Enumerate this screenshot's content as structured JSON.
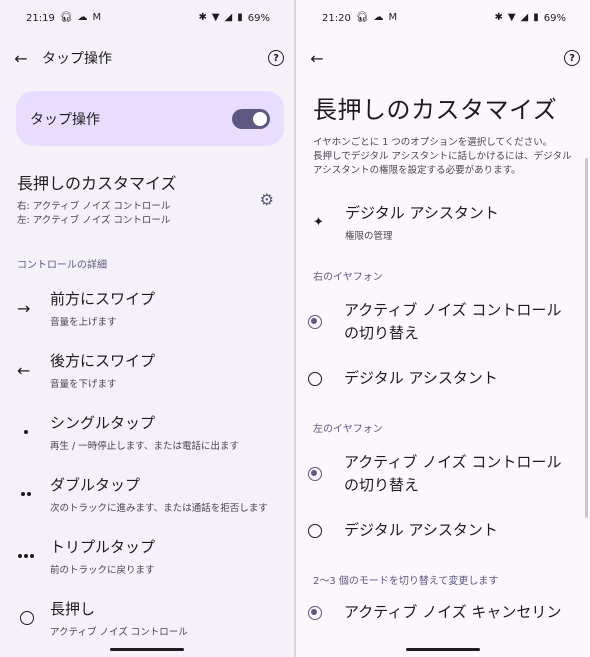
{
  "left": {
    "status": {
      "time": "21:19",
      "battery": "69%"
    },
    "appbar": {
      "title": "タップ操作"
    },
    "master_toggle": {
      "label": "タップ操作",
      "on": true
    },
    "long_press": {
      "title": "長押しのカスタマイズ",
      "right": "右: アクティブ ノイズ コントロール",
      "left": "左: アクティブ ノイズ コントロール"
    },
    "section": "コントロールの詳細",
    "items": [
      {
        "icon": "arrow-right-icon",
        "title": "前方にスワイプ",
        "subtitle": "音量を上げます"
      },
      {
        "icon": "arrow-left-icon",
        "title": "後方にスワイプ",
        "subtitle": "音量を下げます"
      },
      {
        "icon": "single-dot-icon",
        "title": "シングルタップ",
        "subtitle": "再生 / 一時停止します、または電話に出ます"
      },
      {
        "icon": "double-dot-icon",
        "title": "ダブルタップ",
        "subtitle": "次のトラックに進みます、または通話を拒否します"
      },
      {
        "icon": "triple-dot-icon",
        "title": "トリプルタップ",
        "subtitle": "前のトラックに戻ります"
      },
      {
        "icon": "circle-icon",
        "title": "長押し",
        "subtitle": "アクティブ ノイズ コントロール"
      }
    ]
  },
  "right": {
    "status": {
      "time": "21:20",
      "battery": "69%"
    },
    "heading": "長押しのカスタマイズ",
    "description": [
      "イヤホンごとに 1 つのオプションを選択してください。",
      "長押しでデジタル アシスタントに話しかけるには、デジタル",
      "アシスタントの権限を設定する必要があります。"
    ],
    "assistant": {
      "title": "デジタル アシスタント",
      "subtitle": "権限の管理"
    },
    "right_section": "右のイヤフォン",
    "right_options": [
      {
        "label_line1": "アクティブ ノイズ コントロール",
        "label_line2": "の切り替え",
        "selected": true
      },
      {
        "label_line1": "デジタル アシスタント",
        "label_line2": "",
        "selected": false
      }
    ],
    "left_section": "左のイヤフォン",
    "left_options": [
      {
        "label_line1": "アクティブ ノイズ コントロール",
        "label_line2": "の切り替え",
        "selected": true
      },
      {
        "label_line1": "デジタル アシスタント",
        "label_line2": "",
        "selected": false
      }
    ],
    "modes_section": "2〜3 個のモードを切り替えて変更します",
    "modes_partial": "アクティブ ノイズ キャンセリン"
  },
  "colors": {
    "accent": "#5d5781",
    "accent_container": "#e9ddff"
  }
}
